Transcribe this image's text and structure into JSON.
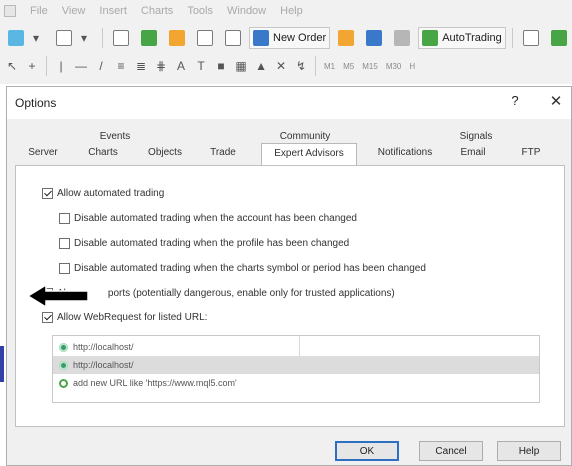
{
  "menubar": {
    "items": [
      "File",
      "View",
      "Insert",
      "Charts",
      "Tools",
      "Window",
      "Help"
    ]
  },
  "toolbar": {
    "new_order_label": "New Order",
    "autotrading_label": "AutoTrading",
    "timeframes": [
      "M1",
      "M5",
      "M15",
      "M30",
      "H"
    ]
  },
  "dialog": {
    "title": "Options",
    "help_glyph": "?",
    "close_glyph": "✕",
    "tabs_row1": [
      "Events",
      "Community",
      "Signals"
    ],
    "tabs_row2": [
      "Server",
      "Charts",
      "Objects",
      "Trade",
      "Expert Advisors",
      "Notifications",
      "Email",
      "FTP"
    ],
    "selected_tab": "Expert Advisors"
  },
  "expert_advisors": {
    "allow_automated_trading": {
      "label": "Allow automated trading",
      "checked": true
    },
    "disable_account_changed": {
      "label": "Disable automated trading when the account has been changed",
      "checked": false
    },
    "disable_profile_changed": {
      "label": "Disable automated trading when the profile has been changed",
      "checked": false
    },
    "disable_symbol_changed": {
      "label": "Disable automated trading when the charts symbol or period has been changed",
      "checked": false
    },
    "allow_dll_imports": {
      "label_prefix": "Al",
      "label_suffix": "ports (potentially dangerous, enable only for trusted applications)",
      "checked": true
    },
    "allow_webrequest": {
      "label": "Allow WebRequest for listed URL:",
      "checked": true
    }
  },
  "url_list": {
    "rows": [
      {
        "url": "http://localhost/",
        "selected": false
      },
      {
        "url": "http://localhost/",
        "selected": true
      }
    ],
    "add_new_text": "add new URL like 'https://www.mql5.com'"
  },
  "buttons": {
    "ok": "OK",
    "cancel": "Cancel",
    "help": "Help"
  },
  "colors": {
    "accent_blue": "#2f6fc2",
    "arrow_black": "#000000",
    "selected_row": "#dcdcdc"
  }
}
